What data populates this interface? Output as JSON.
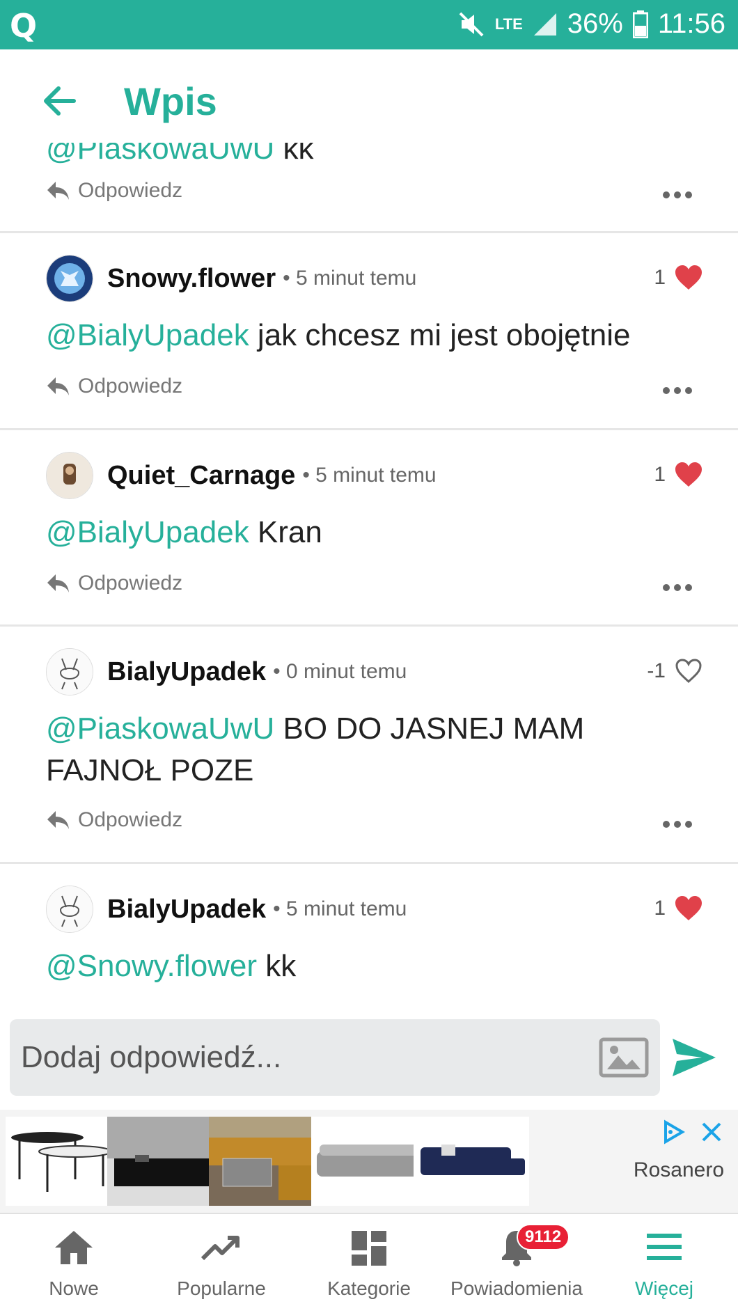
{
  "status_bar": {
    "battery": "36%",
    "time": "11:56",
    "network": "LTE"
  },
  "header": {
    "title": "Wpis"
  },
  "clipped_comment": {
    "mention": "@PiaskowaUwU",
    "text": " kk"
  },
  "reply_label": "Odpowiedz",
  "comments": [
    {
      "user": "Snowy.flower",
      "time": "• 5 minut temu",
      "likes": "1",
      "liked": true,
      "mention": "@BialyUpadek",
      "text": " jak chcesz mi jest obojętnie"
    },
    {
      "user": "Quiet_Carnage",
      "time": "• 5 minut temu",
      "likes": "1",
      "liked": true,
      "mention": "@BialyUpadek",
      "text": " Kran"
    },
    {
      "user": "BialyUpadek",
      "time": "• 0 minut temu",
      "likes": "-1",
      "liked": false,
      "mention": "@PiaskowaUwU",
      "text": " BO DO JASNEJ MAM FAJNOŁ POZE"
    },
    {
      "user": "BialyUpadek",
      "time": "• 5 minut temu",
      "likes": "1",
      "liked": true,
      "mention": "@Snowy.flower",
      "text": " kk"
    }
  ],
  "input": {
    "placeholder": "Dodaj odpowiedź..."
  },
  "ad": {
    "brand": "Rosanero"
  },
  "bottom_nav": {
    "items": [
      {
        "label": "Nowe"
      },
      {
        "label": "Popularne"
      },
      {
        "label": "Kategorie"
      },
      {
        "label": "Powiadomienia",
        "badge": "9112"
      },
      {
        "label": "Więcej"
      }
    ]
  },
  "colors": {
    "accent": "#26b09a",
    "heart": "#e0414a",
    "badge": "#e82035"
  }
}
